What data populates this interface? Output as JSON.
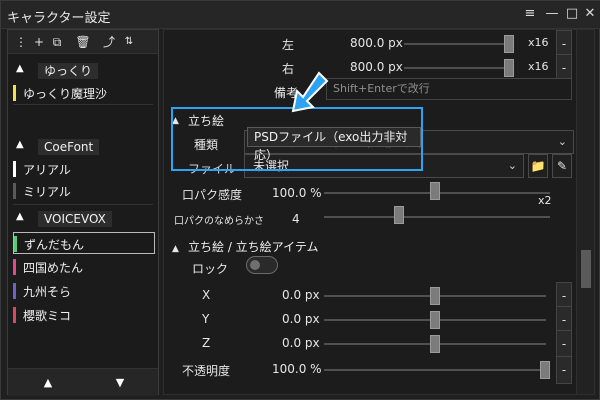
{
  "window": {
    "title": "キャラクター設定",
    "controls": {
      "menu": "≡",
      "minimize": "—",
      "maximize": "□",
      "close": "✕"
    }
  },
  "left_panel": {
    "toolbar_icons": [
      "more-vert-icon",
      "plus-icon",
      "copy-icon",
      "trash-icon",
      "import-icon",
      "sort-icon"
    ],
    "groups": [
      {
        "name": "ゆっくり",
        "items": [
          {
            "label": "ゆっくり魔理沙",
            "color": "#f2e24a",
            "selected": false
          }
        ]
      },
      {
        "name": "CoeFont",
        "items": [
          {
            "label": "アリアル",
            "color": "#ffffff",
            "selected": false
          },
          {
            "label": "ミリアル",
            "color": "#5a5a5a",
            "selected": false
          }
        ]
      },
      {
        "name": "VOICEVOX",
        "items": [
          {
            "label": "ずんだもん",
            "color": "#5ac87a",
            "selected": true
          },
          {
            "label": "四国めたん",
            "color": "#e04b8d",
            "selected": false
          },
          {
            "label": "九州そら",
            "color": "#6c63c8",
            "selected": false
          },
          {
            "label": "櫻歌ミコ",
            "color": "#d64a62",
            "selected": false
          }
        ]
      }
    ],
    "bottom_buttons": {
      "up": "▲",
      "down": "▼"
    }
  },
  "right_panel": {
    "rows_top": [
      {
        "label": "左",
        "value": "800.0 px",
        "suffix": "x16"
      },
      {
        "label": "右",
        "value": "800.0 px",
        "suffix": "x16"
      }
    ],
    "remark": {
      "label": "備考",
      "placeholder": "Shift+Enterで改行"
    },
    "standing_picture": {
      "header": "立ち絵",
      "type_label": "種類",
      "type_value": "PSDファイル（exo出力非対応）",
      "file_label": "ファイル",
      "file_value": "未選択"
    },
    "lip_sync": {
      "label": "口パク感度",
      "value": "100.0 %",
      "suffix": "x2",
      "smooth_label": "口パクのなめらかさ",
      "smooth_value": "4"
    },
    "standing_items": {
      "header": "立ち絵 / 立ち絵アイテム",
      "lock_label": "ロック",
      "rows": [
        {
          "label": "X",
          "value": "0.0 px"
        },
        {
          "label": "Y",
          "value": "0.0 px"
        },
        {
          "label": "Z",
          "value": "0.0 px"
        },
        {
          "label": "不透明度",
          "value": "100.0 %"
        }
      ]
    },
    "misc": {
      "minus_button": "-"
    }
  },
  "colors": {
    "highlight": "#2ea3f2",
    "arrow": "#2ea3f2"
  }
}
